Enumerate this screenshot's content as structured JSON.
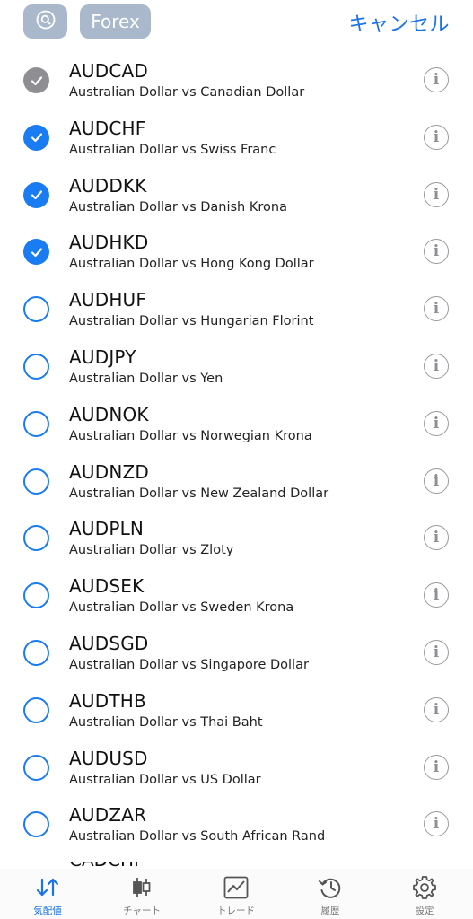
{
  "header": {
    "search_icon": "search-icon",
    "filter_label": "Forex",
    "cancel_label": "キャンセル"
  },
  "symbols": [
    {
      "symbol": "AUDCAD",
      "description": "Australian Dollar vs Canadian Dollar",
      "state": "disabled"
    },
    {
      "symbol": "AUDCHF",
      "description": "Australian Dollar vs Swiss Franc",
      "state": "checked"
    },
    {
      "symbol": "AUDDKK",
      "description": "Australian Dollar vs Danish Krona",
      "state": "checked"
    },
    {
      "symbol": "AUDHKD",
      "description": "Australian Dollar vs Hong Kong Dollar",
      "state": "checked"
    },
    {
      "symbol": "AUDHUF",
      "description": "Australian Dollar vs Hungarian Florint",
      "state": "unchecked"
    },
    {
      "symbol": "AUDJPY",
      "description": "Australian Dollar vs Yen",
      "state": "unchecked"
    },
    {
      "symbol": "AUDNOK",
      "description": "Australian Dollar vs Norwegian Krona",
      "state": "unchecked"
    },
    {
      "symbol": "AUDNZD",
      "description": "Australian Dollar vs New Zealand Dollar",
      "state": "unchecked"
    },
    {
      "symbol": "AUDPLN",
      "description": "Australian Dollar vs Zloty",
      "state": "unchecked"
    },
    {
      "symbol": "AUDSEK",
      "description": "Australian Dollar vs Sweden Krona",
      "state": "unchecked"
    },
    {
      "symbol": "AUDSGD",
      "description": "Australian Dollar vs Singapore Dollar",
      "state": "unchecked"
    },
    {
      "symbol": "AUDTHB",
      "description": "Australian Dollar vs Thai Baht",
      "state": "unchecked"
    },
    {
      "symbol": "AUDUSD",
      "description": "Australian Dollar vs US Dollar",
      "state": "unchecked"
    },
    {
      "symbol": "AUDZAR",
      "description": "Australian Dollar vs South African Rand",
      "state": "unchecked"
    }
  ],
  "partial_row_symbol": "CADCHF",
  "info_glyph": "i",
  "tabs": [
    {
      "label": "気配値",
      "icon": "quotes-arrows-icon",
      "active": true
    },
    {
      "label": "チャート",
      "icon": "candlestick-chart-icon",
      "active": false
    },
    {
      "label": "トレード",
      "icon": "trade-line-chart-icon",
      "active": false
    },
    {
      "label": "履歴",
      "icon": "history-clock-icon",
      "active": false
    },
    {
      "label": "設定",
      "icon": "settings-gear-icon",
      "active": false
    }
  ],
  "colors": {
    "accent": "#1a73e8",
    "checked": "#1a7cf2",
    "disabled": "#8e8e93",
    "pill": "#a9b9cb"
  }
}
